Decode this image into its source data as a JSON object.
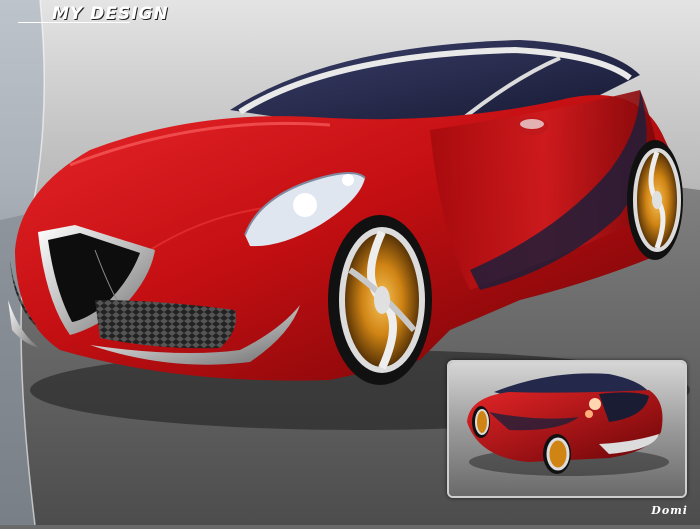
{
  "header": {
    "title": "MY DESIGN"
  },
  "footer": {
    "signature": "Domi"
  },
  "colors": {
    "body_red": "#c40f12",
    "body_dark_red": "#5a0406",
    "glass": "#2a2f55",
    "chrome": "#d8d8d8",
    "wheel_gold": "#e59a18",
    "floor": "#3a3a3a",
    "sky": "#d9d9d9"
  },
  "images": {
    "main_car": "red-concept-car-front-three-quarter",
    "inset_car": "red-concept-car-rear-three-quarter"
  }
}
